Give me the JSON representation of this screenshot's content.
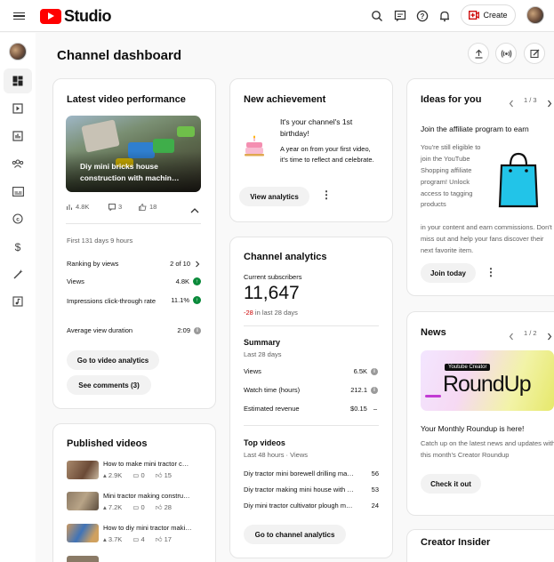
{
  "app": {
    "logo_text": "Studio",
    "create_label": "Create"
  },
  "colors": {
    "brand_red": "#ff0000",
    "positive": "#0a8a3a",
    "negative": "#cc0000",
    "bag": "#22c4e8"
  },
  "icons": {
    "topbar": [
      "menu-icon",
      "youtube-logo-icon",
      "search-icon",
      "feedback-icon",
      "help-icon",
      "bell-icon",
      "create-video-icon"
    ],
    "sidebar": [
      "dashboard-icon",
      "content-icon",
      "analytics-icon",
      "community-icon",
      "subtitles-icon",
      "copyright-icon",
      "earn-icon",
      "customization-icon",
      "audio-library-icon"
    ],
    "header": [
      "upload-icon",
      "live-icon",
      "edit-icon"
    ]
  },
  "dashboard": {
    "title": "Channel dashboard"
  },
  "latest": {
    "title": "Latest video performance",
    "thumb_title": "Diy mini bricks house construction with machin…",
    "views": "4.8K",
    "comments": "3",
    "likes": "18",
    "period": "First 131 days 9 hours",
    "ranking_label": "Ranking by views",
    "ranking_value": "2 of 10",
    "views_label": "Views",
    "views_value": "4.8K",
    "ctr_label": "Impressions click-through rate",
    "ctr_value": "11.1%",
    "avd_label": "Average view duration",
    "avd_value": "2:09",
    "go_label": "Go to video analytics",
    "comments_label": "See comments (3)"
  },
  "achievement": {
    "title": "New achievement",
    "headline": "It's your channel's 1st birthday!",
    "body": "A year on from your first video, it's time to reflect and celebrate.",
    "button": "View analytics"
  },
  "ideas": {
    "title": "Ideas for you",
    "pager": "1 / 3",
    "headline": "Join the affiliate program to earn",
    "body_narrow": "You're still eligible to join the YouTube Shopping affiliate program! Unlock access to tagging products",
    "body_wide": "in your content and earn commissions. Don't miss out and help your fans discover their next favorite item.",
    "button": "Join today"
  },
  "analytics": {
    "title": "Channel analytics",
    "subs_label": "Current subscribers",
    "subs_value": "11,647",
    "subs_change": "-28",
    "subs_change_suffix": " in last 28 days",
    "summary_title": "Summary",
    "summary_period": "Last 28 days",
    "rows": [
      {
        "label": "Views",
        "value": "6.5K"
      },
      {
        "label": "Watch time (hours)",
        "value": "212.1"
      },
      {
        "label": "Estimated revenue",
        "value": "$0.15"
      }
    ],
    "top_title": "Top videos",
    "top_period": "Last 48 hours · Views",
    "top_videos": [
      {
        "title": "Diy tractor mini borewell drilling ma…",
        "views": "56"
      },
      {
        "title": "Diy tractor making mini house with …",
        "views": "53"
      },
      {
        "title": "Diy mini tractor cultivator plough m…",
        "views": "24"
      }
    ],
    "button": "Go to channel analytics"
  },
  "published": {
    "title": "Published videos",
    "items": [
      {
        "title": "How to make mini tractor c…",
        "views": "2.9K",
        "comments": "0",
        "likes": "15"
      },
      {
        "title": "Mini tractor making constru…",
        "views": "7.2K",
        "comments": "0",
        "likes": "28"
      },
      {
        "title": "How to diy mini tractor maki…",
        "views": "3.7K",
        "comments": "4",
        "likes": "17"
      }
    ]
  },
  "news": {
    "title": "News",
    "pager": "1 / 2",
    "banner_small": "Youtube Creator",
    "banner_big": "RoundUp",
    "headline": "Your Monthly Roundup is here!",
    "body": "Catch up on the latest news and updates with this month's Creator Roundup",
    "button": "Check it out"
  },
  "insider": {
    "title": "Creator Insider"
  }
}
